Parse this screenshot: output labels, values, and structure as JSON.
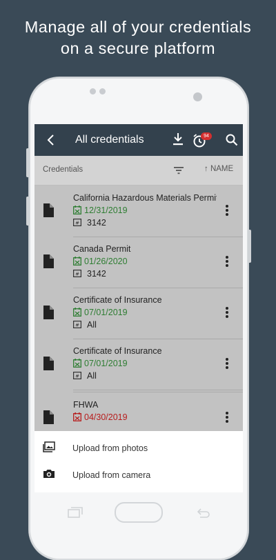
{
  "headline": {
    "line1": "Manage all of your credentials",
    "line2": "on a secure platform"
  },
  "appbar": {
    "back_icon": "arrow-back-icon",
    "title": "All credentials",
    "download_icon": "download-icon",
    "alarm_icon": "alarm-clock-icon",
    "alarm_badge": "94",
    "search_icon": "search-icon"
  },
  "subbar": {
    "label": "Credentials",
    "filter_icon": "filter-icon",
    "sort_label": "↑ NAME"
  },
  "credentials": [
    {
      "name": "California Hazardous Materials Permit",
      "date": "12/31/2019",
      "date_color": "#2e7d32",
      "number": "3142"
    },
    {
      "name": "Canada Permit",
      "date": "01/26/2020",
      "date_color": "#2e7d32",
      "number": "3142"
    },
    {
      "name": "Certificate of Insurance",
      "date": "07/01/2019",
      "date_color": "#2e7d32",
      "number": "All"
    },
    {
      "name": "Certificate of Insurance",
      "date": "07/01/2019",
      "date_color": "#2e7d32",
      "number": "All"
    },
    {
      "name": "FHWA",
      "date": "04/30/2019",
      "date_color": "#b71c1c",
      "number": ""
    }
  ],
  "sheet": {
    "upload_photos": "Upload from photos",
    "upload_camera": "Upload from camera"
  },
  "colors": {
    "background": "#3a4a57",
    "appbar": "#33414d",
    "valid_date": "#2e7d32",
    "expired_date": "#b71c1c",
    "badge": "#d32f2f"
  }
}
